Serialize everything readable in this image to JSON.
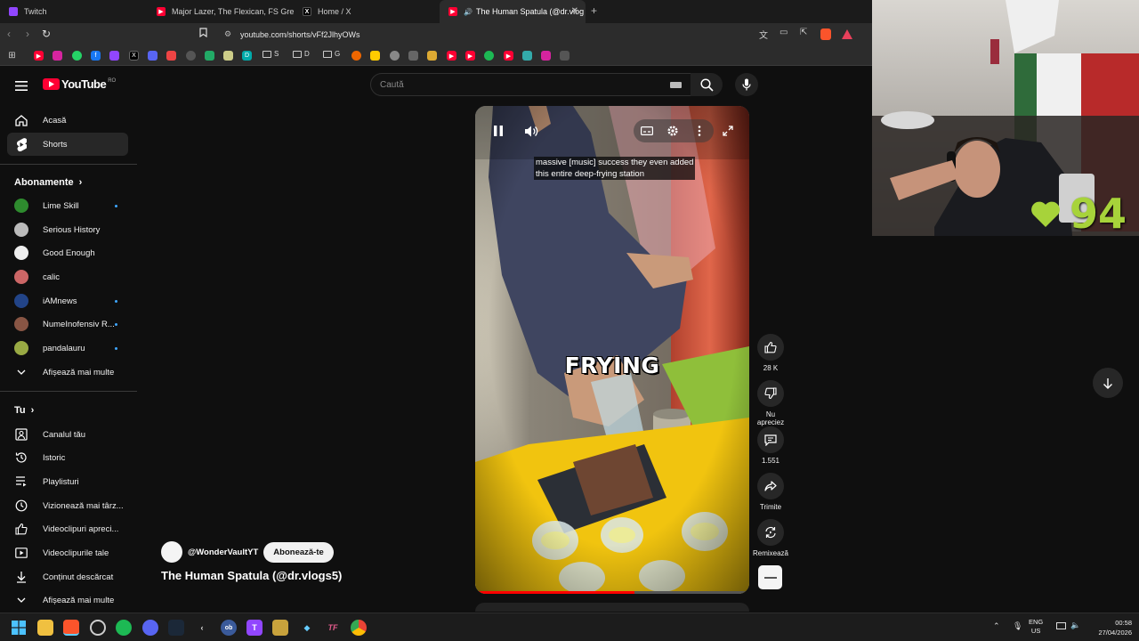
{
  "browser": {
    "tabs": [
      {
        "label": "Twitch",
        "icon": "twitch-icon",
        "color": "#9146ff",
        "active": false
      },
      {
        "label": "Major Lazer, The Flexican, FS Green &",
        "icon": "youtube-icon",
        "color": "#ff0033",
        "active": false
      },
      {
        "label": "Home / X",
        "icon": "x-icon",
        "color": "#000000",
        "active": false
      },
      {
        "label": "The Human Spatula (@dr.vlog",
        "icon": "youtube-icon",
        "color": "#ff0033",
        "active": true
      }
    ],
    "url": "youtube.com/shorts/vFf2JlhyOWs",
    "bookmark_folders": [
      "S",
      "D",
      "G"
    ]
  },
  "youtube": {
    "logo_text": "YouTube",
    "region": "RO",
    "search_placeholder": "Caută",
    "sidebar": {
      "main": [
        {
          "label": "Acasă",
          "icon": "home-icon"
        },
        {
          "label": "Shorts",
          "icon": "shorts-icon",
          "active": true
        }
      ],
      "subscriptions_heading": "Abonamente",
      "subscriptions": [
        {
          "label": "Lime Skill",
          "color": "#2e8b2e",
          "dot": true
        },
        {
          "label": "Serious History",
          "color": "#bbbbbb",
          "dot": false
        },
        {
          "label": "Good Enough",
          "color": "#eeeeee",
          "dot": false
        },
        {
          "label": "calic",
          "color": "#cc6666",
          "dot": false
        },
        {
          "label": "iAMnews",
          "color": "#224488",
          "dot": true
        },
        {
          "label": "NumeInofensiv R...",
          "color": "#885544",
          "dot": true
        },
        {
          "label": "pandalauru",
          "color": "#99aa44",
          "dot": true
        }
      ],
      "show_more": "Afișează mai multe",
      "you_heading": "Tu",
      "you_items": [
        {
          "label": "Canalul tău",
          "icon": "channel-icon"
        },
        {
          "label": "Istoric",
          "icon": "history-icon"
        },
        {
          "label": "Playlisturi",
          "icon": "playlists-icon"
        },
        {
          "label": "Vizionează mai târz...",
          "icon": "watch-later-icon"
        },
        {
          "label": "Videoclipuri apreci...",
          "icon": "liked-videos-icon"
        },
        {
          "label": "Videoclipurile tale",
          "icon": "your-videos-icon"
        },
        {
          "label": "Conținut descărcat",
          "icon": "downloads-icon"
        },
        {
          "label": "Afișează mai multe",
          "icon": "chevron-down-icon"
        }
      ]
    },
    "short": {
      "caption_line1": "massive [music] success they even added",
      "caption_line2": "this entire deep-frying station",
      "overlay_text": "FRYING",
      "progress": 0.58,
      "channel_handle": "@WonderVaultYT",
      "subscribe_label": "Abonează-te",
      "title": "The Human Spatula (@dr.vlogs5)",
      "likes": "28 K",
      "dislike_label": "Nu apreciez",
      "comments": "1.551",
      "share_label": "Trimite",
      "remix_label": "Remixează"
    }
  },
  "overlay": {
    "heart_count": "94",
    "heart_color": "#a7d33a"
  },
  "taskbar": {
    "lang_line1": "ENG",
    "lang_line2": "US",
    "time": "00:58",
    "date": "27/04/2026"
  }
}
